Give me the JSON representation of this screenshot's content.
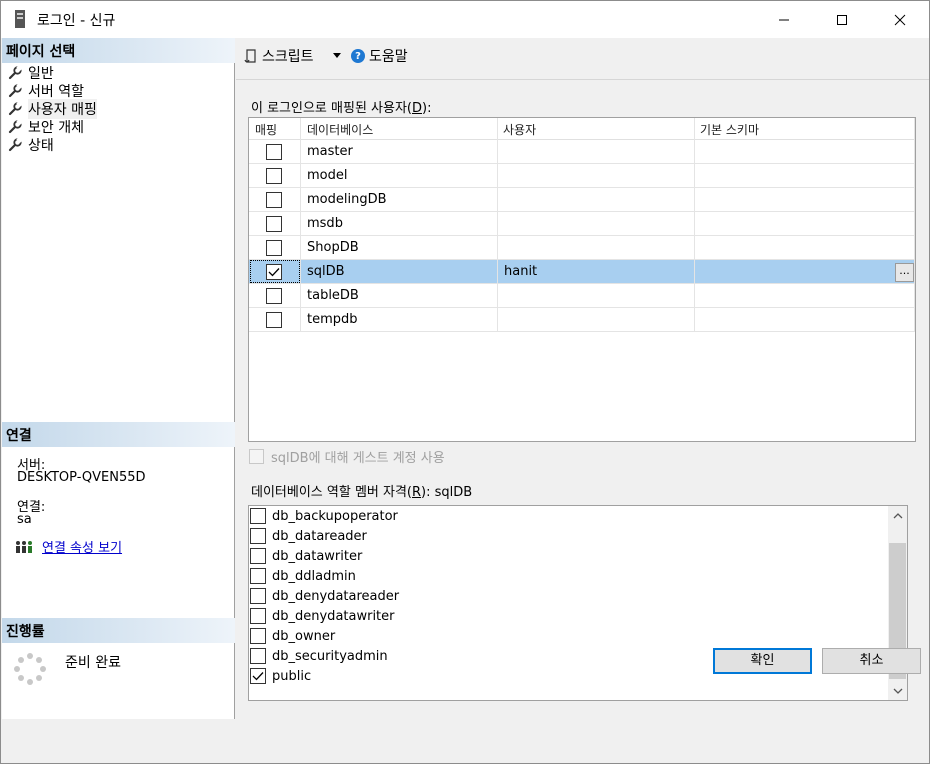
{
  "window": {
    "title": "로그인 - 신규"
  },
  "left_panel": {
    "pages_header": "페이지 선택",
    "nav_items": [
      {
        "label": "일반",
        "icon": "wrench-icon",
        "selected": false
      },
      {
        "label": "서버 역할",
        "icon": "wrench-icon",
        "selected": false
      },
      {
        "label": "사용자 매핑",
        "icon": "wrench-icon",
        "selected": true
      },
      {
        "label": "보안 개체",
        "icon": "wrench-icon",
        "selected": false
      },
      {
        "label": "상태",
        "icon": "wrench-icon",
        "selected": false
      }
    ],
    "connection_header": "연결",
    "server_label": "서버:",
    "server_value": "DESKTOP-QVEN55D",
    "connection_label": "연결:",
    "connection_value": "sa",
    "connection_link": "연결 속성 보기",
    "progress_header": "진행률",
    "progress_status": "준비 완료"
  },
  "toolbar": {
    "script_label": "스크립트",
    "help_label": "도움말"
  },
  "mapping": {
    "label_prefix": "이 로그인으로 매핑된 사용자(",
    "label_key": "D",
    "label_suffix": "):",
    "columns": [
      "매핑",
      "데이터베이스",
      "사용자",
      "기본 스키마"
    ],
    "rows": [
      {
        "mapped": false,
        "database": "master",
        "user": "",
        "schema": ""
      },
      {
        "mapped": false,
        "database": "model",
        "user": "",
        "schema": ""
      },
      {
        "mapped": false,
        "database": "modelingDB",
        "user": "",
        "schema": ""
      },
      {
        "mapped": false,
        "database": "msdb",
        "user": "",
        "schema": ""
      },
      {
        "mapped": false,
        "database": "ShopDB",
        "user": "",
        "schema": ""
      },
      {
        "mapped": true,
        "database": "sqlDB",
        "user": "hanit",
        "schema": "",
        "selected": true
      },
      {
        "mapped": false,
        "database": "tableDB",
        "user": "",
        "schema": ""
      },
      {
        "mapped": false,
        "database": "tempdb",
        "user": "",
        "schema": ""
      }
    ],
    "ellipsis": "..."
  },
  "guest": {
    "label": "sqlDB에 대해 게스트 계정 사용",
    "checked": false,
    "enabled": false
  },
  "roles": {
    "label_prefix": "데이터베이스 역할 멤버 자격(",
    "label_key": "R",
    "label_suffix": "): sqlDB",
    "items": [
      {
        "name": "db_backupoperator",
        "checked": false
      },
      {
        "name": "db_datareader",
        "checked": false
      },
      {
        "name": "db_datawriter",
        "checked": false
      },
      {
        "name": "db_ddladmin",
        "checked": false
      },
      {
        "name": "db_denydatareader",
        "checked": false
      },
      {
        "name": "db_denydatawriter",
        "checked": false
      },
      {
        "name": "db_owner",
        "checked": false
      },
      {
        "name": "db_securityadmin",
        "checked": false
      },
      {
        "name": "public",
        "checked": true
      }
    ]
  },
  "buttons": {
    "ok": "확인",
    "cancel": "취소"
  },
  "colors": {
    "selected_row": "#a8cff0",
    "link": "#0000cc",
    "ok_border": "#0078d7"
  }
}
